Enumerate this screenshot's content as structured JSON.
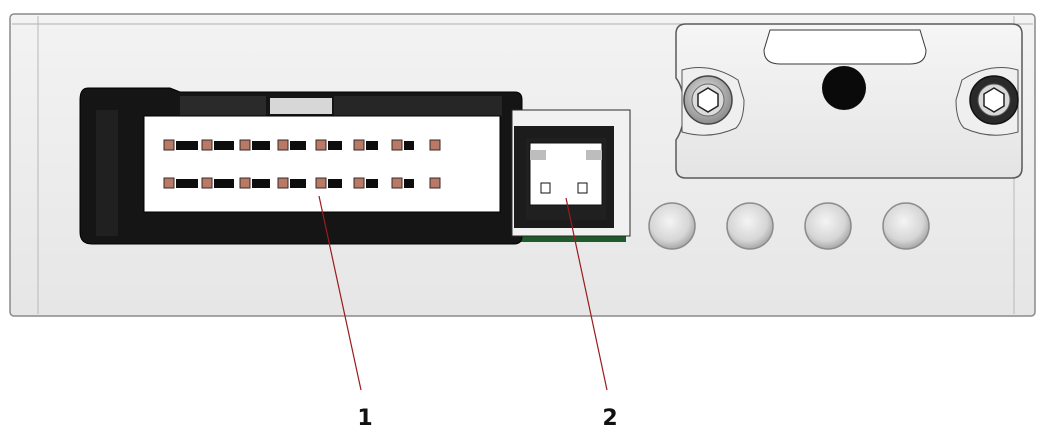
{
  "callouts": [
    {
      "id": "1",
      "label": "1",
      "target": "main-connector"
    },
    {
      "id": "2",
      "label": "2",
      "target": "small-connector"
    }
  ],
  "colors": {
    "housing": "#ececec",
    "housing_edge": "#8a8a8a",
    "connector_shell": "#151515",
    "pin": "#b87a66",
    "pcb": "#1e5a2a",
    "leader_line": "#9b1b1b",
    "led": "#d8d8d8"
  },
  "parts": {
    "main_connector_pins_per_row": 8,
    "main_connector_rows": 2,
    "small_connector_pins": 2,
    "indicator_leds": 4,
    "cover_screws": 2
  }
}
